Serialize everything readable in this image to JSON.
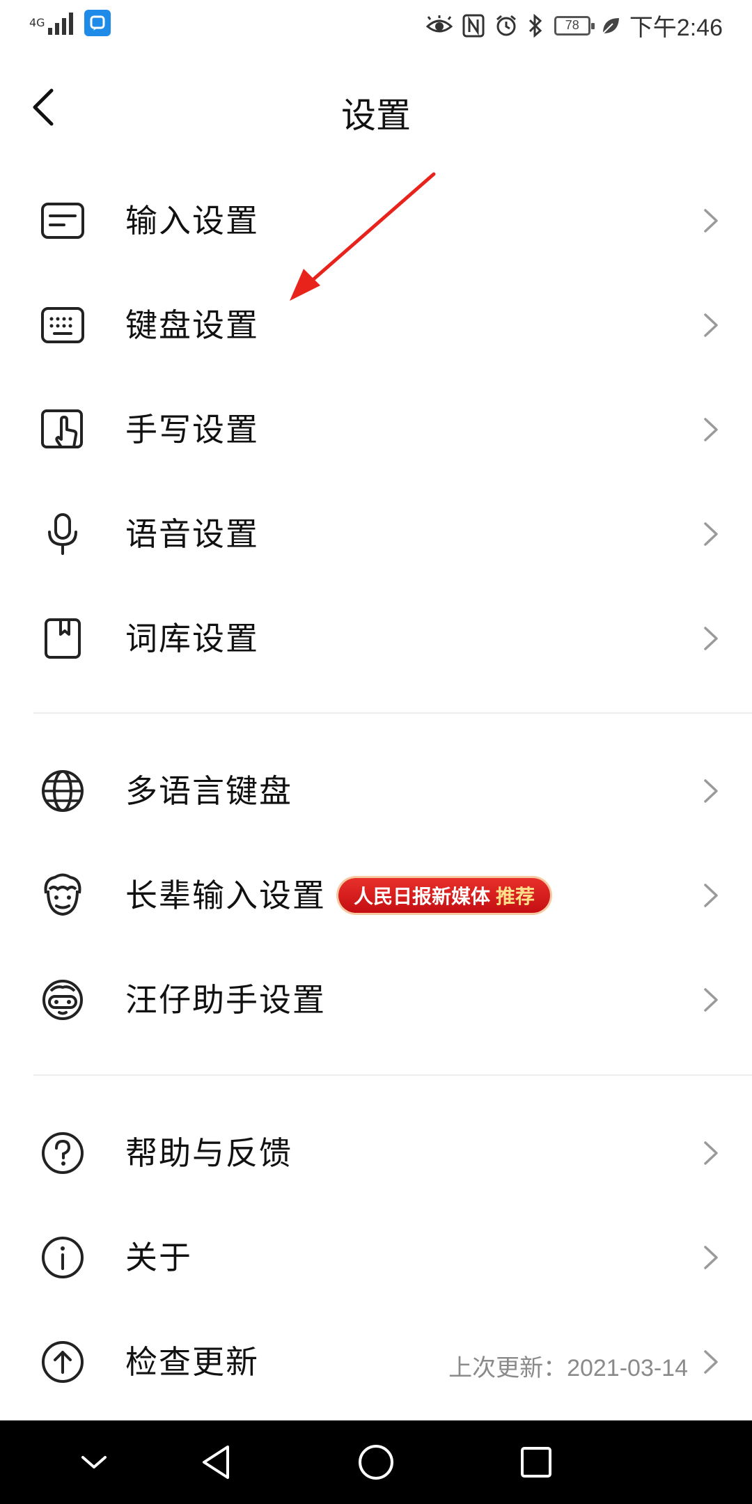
{
  "status_bar": {
    "network_type": "4G",
    "time": "下午2:46",
    "battery_level": "78",
    "icons": [
      "signal-icon",
      "app-notification-icon",
      "eye-icon",
      "nfc-icon",
      "alarm-icon",
      "bluetooth-icon",
      "battery-icon",
      "leaf-icon"
    ]
  },
  "header": {
    "title": "设置",
    "back_icon": "chevron-left-icon"
  },
  "groups": [
    {
      "items": [
        {
          "label": "输入设置",
          "icon": "input-icon"
        },
        {
          "label": "键盘设置",
          "icon": "keyboard-icon"
        },
        {
          "label": "手写设置",
          "icon": "handwriting-icon"
        },
        {
          "label": "语音设置",
          "icon": "microphone-icon"
        },
        {
          "label": "词库设置",
          "icon": "dictionary-icon"
        }
      ]
    },
    {
      "items": [
        {
          "label": "多语言键盘",
          "icon": "globe-icon"
        },
        {
          "label": "长辈输入设置",
          "icon": "elder-icon",
          "badge": {
            "text": "人民日报新媒体",
            "tag": "推荐"
          }
        },
        {
          "label": "汪仔助手设置",
          "icon": "assistant-icon"
        }
      ]
    },
    {
      "items": [
        {
          "label": "帮助与反馈",
          "icon": "help-icon"
        },
        {
          "label": "关于",
          "icon": "info-icon"
        },
        {
          "label": "检查更新",
          "icon": "update-icon",
          "meta": "上次更新：2021-03-14"
        }
      ]
    }
  ],
  "nav_bar": {
    "icons": [
      "nav-collapse-icon",
      "nav-back-icon",
      "nav-home-icon",
      "nav-recents-icon"
    ]
  },
  "colors": {
    "background": "#ffffff",
    "text": "#111111",
    "secondary_text": "#8a8a8a",
    "badge_red": "#d81e1e",
    "annotation_red": "#e8231c",
    "nav_background": "#000000"
  }
}
